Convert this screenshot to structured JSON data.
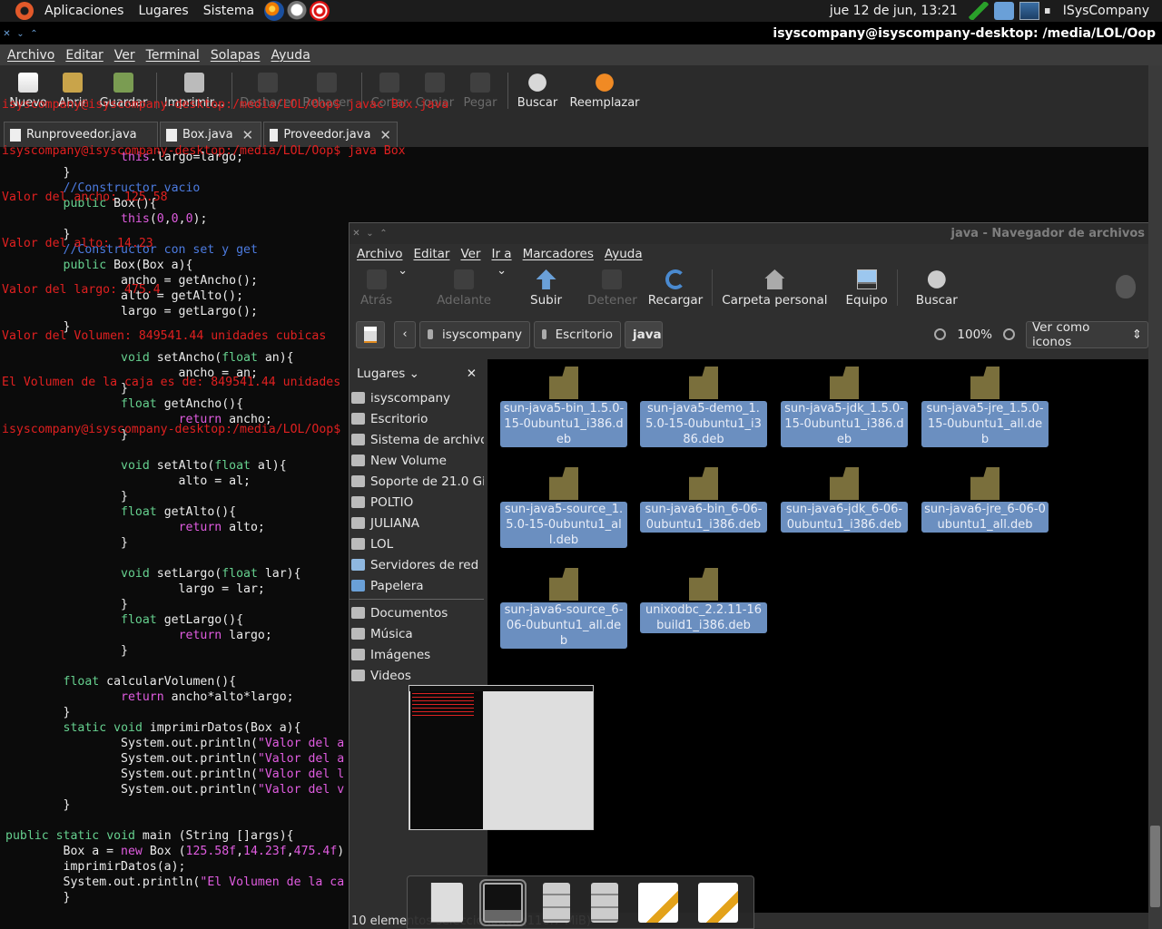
{
  "top_panel": {
    "menus": [
      "Aplicaciones",
      "Lugares",
      "Sistema"
    ],
    "clock": "jue 12 de jun, 13:21",
    "user": "ISysCompany"
  },
  "terminal": {
    "title": "isyscompany@isyscompany-desktop: /media/LOL/Oop",
    "menus": [
      "Archivo",
      "Editar",
      "Ver",
      "Terminal",
      "Solapas",
      "Ayuda"
    ],
    "lines": [
      "isyscompany@isyscompany-desktop:/media/LOL/Oop$ javac Box.java",
      "isyscompany@isyscompany-desktop:/media/LOL/Oop$ java Box",
      "Valor del ancho: 125.58",
      "Valor del alto: 14.23",
      "Valor del largo: 475.4",
      "Valor del Volumen: 849541.44 unidades cubicas",
      "El Volumen de la caja es de: 849541.44 unidades cubicas",
      "isyscompany@isyscompany-desktop:/media/LOL/Oop$ "
    ]
  },
  "gedit": {
    "toolbar": [
      "Nuevo",
      "Abrir",
      "Guardar",
      "Imprimir...",
      "Deshacer",
      "Rehacer",
      "Cortar",
      "Copiar",
      "Pegar",
      "Buscar",
      "Reemplazar"
    ],
    "tabs": [
      "Runproveedor.java",
      "Box.java",
      "Proveedor.java"
    ],
    "code": [
      "                this.largo=largo;",
      "        }",
      "        //Constructor vacio",
      "        public Box(){",
      "                this(0,0,0);",
      "        }",
      "        //Constructor con set y get",
      "        public Box(Box a){",
      "                ancho = getAncho();",
      "                alto = getAlto();",
      "                largo = getLargo();",
      "        }",
      "",
      "                void setAncho(float an){",
      "                        ancho = an;",
      "                }",
      "                float getAncho(){",
      "                        return ancho;",
      "                }",
      "",
      "                void setAlto(float al){",
      "                        alto = al;",
      "                }",
      "                float getAlto(){",
      "                        return alto;",
      "                }",
      "",
      "                void setLargo(float lar){",
      "                        largo = lar;",
      "                }",
      "                float getLargo(){",
      "                        return largo;",
      "                }",
      "",
      "        float calcularVolumen(){",
      "                return ancho*alto*largo;",
      "        }",
      "        static void imprimirDatos(Box a){",
      "                System.out.println(\"Valor del a",
      "                System.out.println(\"Valor del a",
      "                System.out.println(\"Valor del l",
      "                System.out.println(\"Valor del v",
      "        }",
      "",
      "public static void main (String []args){",
      "        Box a = new Box (125.58f,14.23f,475.4f)",
      "        imprimirDatos(a);",
      "        System.out.println(\"El Volumen de la ca",
      "        }",
      "}"
    ]
  },
  "nautilus": {
    "title": "java - Navegador de archivos",
    "menus": [
      "Archivo",
      "Editar",
      "Ver",
      "Ir a",
      "Marcadores",
      "Ayuda"
    ],
    "toolbar": {
      "back": "Atrás",
      "forward": "Adelante",
      "up": "Subir",
      "stop": "Detener",
      "reload": "Recargar",
      "home": "Carpeta personal",
      "computer": "Equipo",
      "search": "Buscar"
    },
    "path": [
      "isyscompany",
      "Escritorio",
      "java"
    ],
    "zoom": "100%",
    "view_mode": "Ver como iconos",
    "sidebar_title": "Lugares",
    "places": [
      "isyscompany",
      "Escritorio",
      "Sistema de archivos",
      "New Volume",
      "Soporte de 21.0 GiB",
      "POLTIO",
      "JULIANA",
      "LOL",
      "Servidores de red",
      "Papelera"
    ],
    "bookmarks": [
      "Documentos",
      "Música",
      "Imágenes",
      "Videos"
    ],
    "files": [
      "sun-java5-bin_1.5.0-15-0ubuntu1_i386.deb",
      "sun-java5-demo_1.5.0-15-0ubuntu1_i386.deb",
      "sun-java5-jdk_1.5.0-15-0ubuntu1_i386.deb",
      "sun-java5-jre_1.5.0-15-0ubuntu1_all.deb",
      "sun-java5-source_1.5.0-15-0ubuntu1_all.deb",
      "sun-java6-bin_6-06-0ubuntu1_i386.deb",
      "sun-java6-jdk_6-06-0ubuntu1_i386.deb",
      "sun-java6-jre_6-06-0ubuntu1_all.deb",
      "sun-java6-source_6-06-0ubuntu1_all.deb",
      "unixodbc_2.2.11-16build1_i386.deb"
    ],
    "status": "10 elementos seleccionados (116.7 MiB)"
  }
}
